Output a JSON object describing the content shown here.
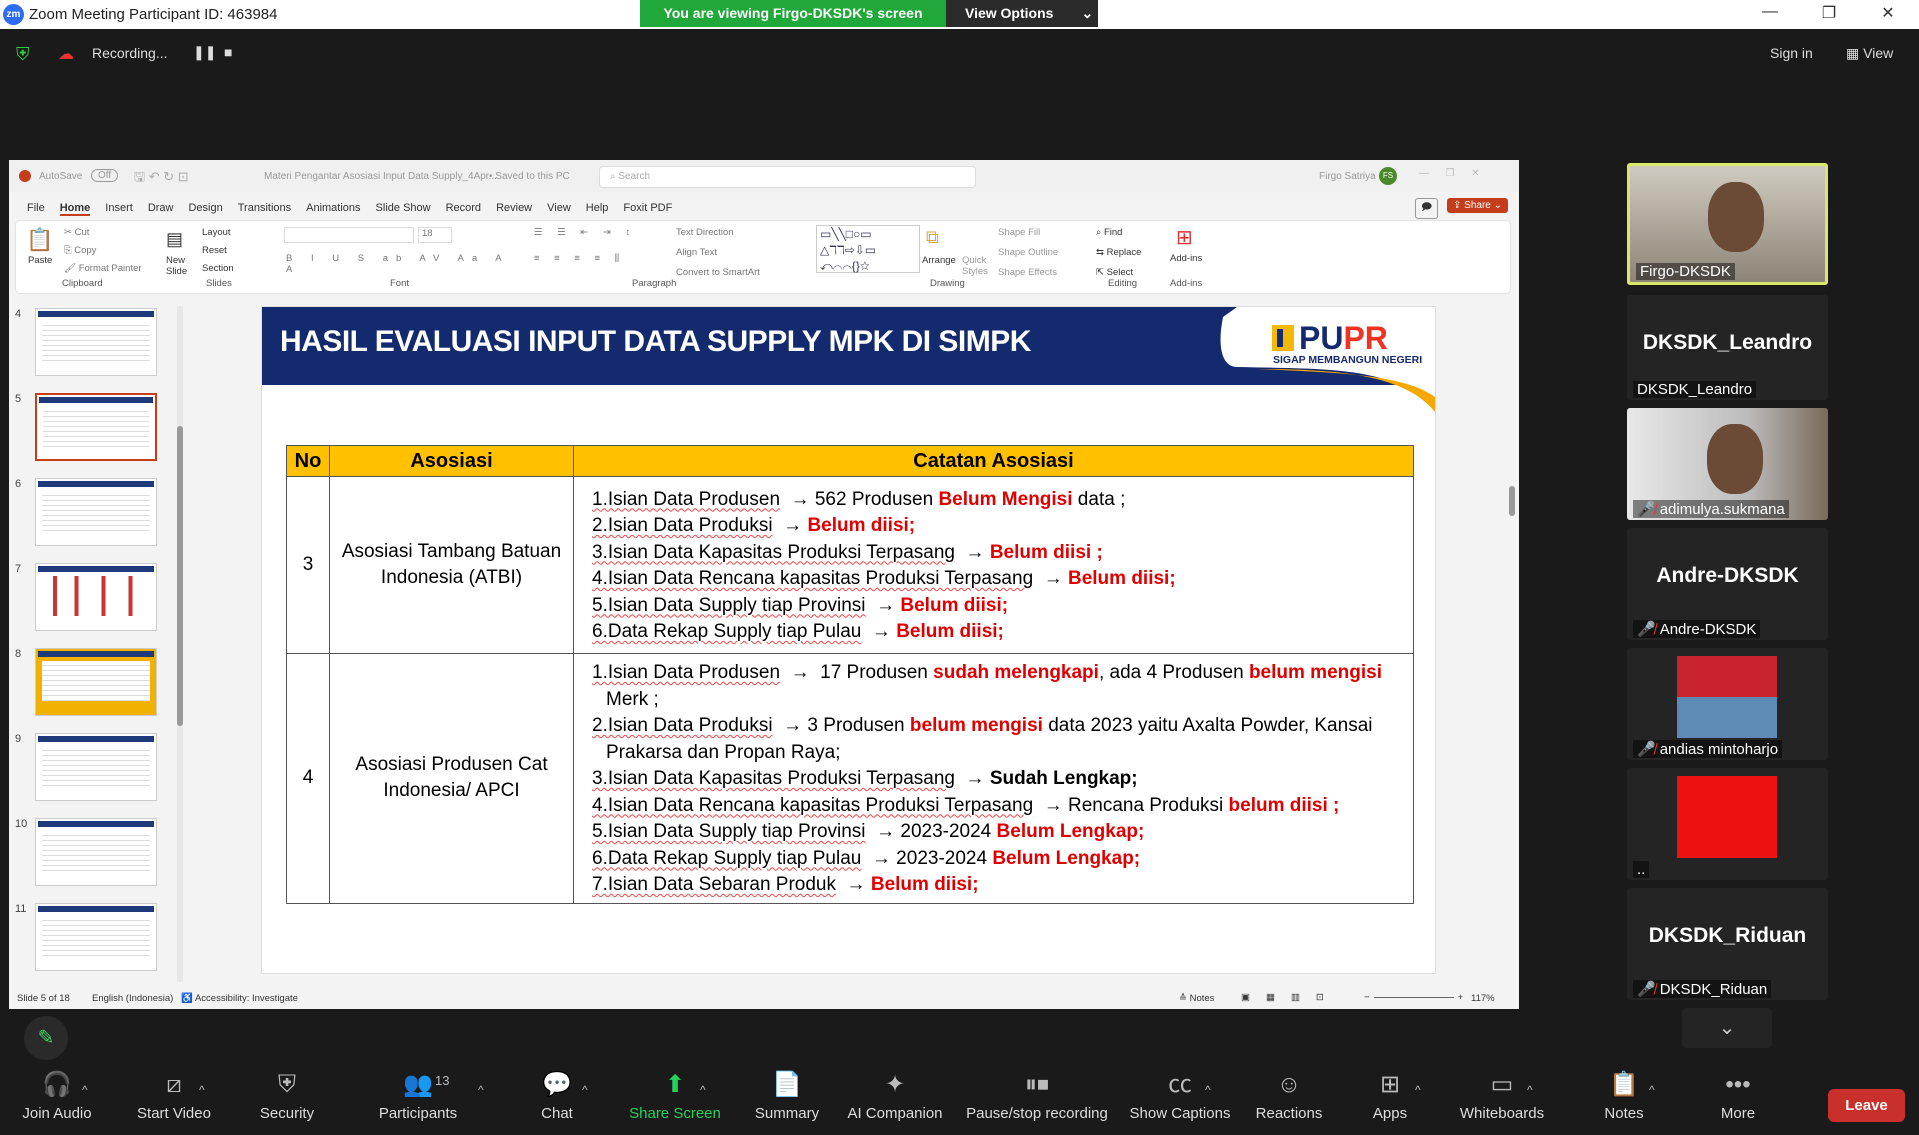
{
  "window": {
    "title": "Zoom Meeting Participant ID: 463984",
    "logo": "zm",
    "viewing": "You are viewing Firgo-DKSDK's screen",
    "view_options": "View Options"
  },
  "recording": {
    "label": "Recording...",
    "sign_in": "Sign in",
    "view": "View"
  },
  "ppt": {
    "autosave": "AutoSave",
    "autosave_state": "Off",
    "filename": "Materi Pengantar Asosiasi Input Data Supply_4Apr...",
    "saved": "• Saved to this PC",
    "search_placeholder": "Search",
    "user": "Firgo Satriya",
    "user_initials": "FS",
    "tabs": [
      "File",
      "Home",
      "Insert",
      "Draw",
      "Design",
      "Transitions",
      "Animations",
      "Slide Show",
      "Record",
      "Review",
      "View",
      "Help",
      "Foxit PDF"
    ],
    "share": "Share",
    "groups": {
      "clipboard": "Clipboard",
      "slides": "Slides",
      "font": "Font",
      "paragraph": "Paragraph",
      "drawing": "Drawing",
      "editing": "Editing",
      "addins": "Add-ins"
    },
    "buttons": {
      "paste": "Paste",
      "cut": "Cut",
      "copy": "Copy",
      "format_painter": "Format Painter",
      "new_slide": "New Slide",
      "layout": "Layout",
      "reset": "Reset",
      "section": "Section",
      "font_size": "18",
      "text_direction": "Text Direction",
      "align_text": "Align Text",
      "convert_smartart": "Convert to SmartArt",
      "arrange": "Arrange",
      "quick_styles": "Quick Styles",
      "shape_fill": "Shape Fill",
      "shape_outline": "Shape Outline",
      "shape_effects": "Shape Effects",
      "find": "Find",
      "replace": "Replace",
      "select": "Select",
      "addins": "Add-ins"
    },
    "thumbnails": [
      "4",
      "5",
      "6",
      "7",
      "8",
      "9",
      "10",
      "11"
    ],
    "active_thumbnail": "5",
    "status": {
      "slide": "Slide 5 of 18",
      "language": "English (Indonesia)",
      "accessibility": "Accessibility: Investigate",
      "notes": "Notes",
      "zoom": "117%"
    }
  },
  "slide": {
    "title": "HASIL EVALUASI INPUT DATA SUPPLY MPK DI SIMPK",
    "logo": "PUPR",
    "logo_tagline": "SIGAP MEMBANGUN NEGERI",
    "headers": [
      "No",
      "Asosiasi",
      "Catatan Asosiasi"
    ],
    "rows": [
      {
        "no": "3",
        "asosiasi": "Asosiasi Tambang Batuan Indonesia (ATBI)",
        "notes": [
          [
            [
              "1.Isian Data Produsen",
              "u"
            ],
            [
              "  → 562 Produsen ",
              ""
            ],
            [
              "Belum Mengisi",
              "r"
            ],
            [
              " data ;",
              ""
            ]
          ],
          [
            [
              "2.Isian Data Produksi",
              "u"
            ],
            [
              "  → ",
              ""
            ],
            [
              "Belum diisi;",
              "r"
            ]
          ],
          [
            [
              "3.Isian Data Kapasitas Produksi Terpasang",
              "u"
            ],
            [
              "  → ",
              ""
            ],
            [
              "Belum diisi ;",
              "r"
            ]
          ],
          [
            [
              "4.Isian Data Rencana kapasitas Produksi Terpasang",
              "u"
            ],
            [
              "  → ",
              ""
            ],
            [
              "Belum diisi;",
              "r"
            ]
          ],
          [
            [
              "5.Isian Data Supply tiap Provinsi",
              "u"
            ],
            [
              "  → ",
              ""
            ],
            [
              "Belum diisi;",
              "r"
            ]
          ],
          [
            [
              "6.Data Rekap Supply tiap Pulau",
              "u"
            ],
            [
              "  → ",
              ""
            ],
            [
              "Belum diisi;",
              "r"
            ]
          ]
        ]
      },
      {
        "no": "4",
        "asosiasi": "Asosiasi Produsen Cat Indonesia/ APCI",
        "notes": [
          [
            [
              "1.Isian Data Produsen",
              "u"
            ],
            [
              "  →  17 Produsen ",
              ""
            ],
            [
              "sudah melengkapi",
              "r"
            ],
            [
              ", ada 4 Produsen ",
              ""
            ],
            [
              "belum mengisi",
              "r"
            ],
            [
              " Merk ;",
              ""
            ]
          ],
          [
            [
              "2.Isian Data Produksi",
              "u"
            ],
            [
              "  → 3 Produsen ",
              ""
            ],
            [
              "belum mengisi",
              "r"
            ],
            [
              " data 2023 yaitu Axalta Powder, Kansai Prakarsa dan Propan Raya;",
              ""
            ]
          ],
          [
            [
              "3.Isian Data Kapasitas Produksi Terpasang",
              "u"
            ],
            [
              "  → ",
              ""
            ],
            [
              "Sudah Lengkap;",
              "b"
            ]
          ],
          [
            [
              "4.Isian Data Rencana kapasitas Produksi Terpasang",
              "u"
            ],
            [
              "  → Rencana Produksi ",
              ""
            ],
            [
              "belum diisi ;",
              "r"
            ]
          ],
          [
            [
              "5.Isian Data Supply tiap Provinsi",
              "u"
            ],
            [
              "  → 2023-2024 ",
              ""
            ],
            [
              "Belum Lengkap;",
              "r"
            ]
          ],
          [
            [
              "6.Data Rekap Supply tiap Pulau",
              "u"
            ],
            [
              "  → 2023-2024 ",
              ""
            ],
            [
              "Belum Lengkap;",
              "r"
            ]
          ],
          [
            [
              "7.Isian Data Sebaran Produk",
              "u"
            ],
            [
              "  → ",
              ""
            ],
            [
              "Belum diisi;",
              "r"
            ]
          ]
        ]
      }
    ]
  },
  "participants": [
    {
      "name": "Firgo-DKSDK",
      "type": "video",
      "active": true
    },
    {
      "name": "DKSDK_Leandro",
      "big": "DKSDK_Leandro",
      "type": "name"
    },
    {
      "name": "adimulya.sukmana",
      "type": "video",
      "muted": true
    },
    {
      "name": "Andre-DKSDK",
      "big": "Andre-DKSDK",
      "type": "name",
      "muted": true
    },
    {
      "name": "andias mintoharjo",
      "type": "image",
      "muted": true
    },
    {
      "name": "..",
      "type": "image"
    },
    {
      "name": "DKSDK_Riduan",
      "big": "DKSDK_Riduan",
      "type": "name",
      "muted": true
    }
  ],
  "toolbar": [
    {
      "label": "Join Audio",
      "icon": "headphones-icon",
      "glyph": "🎧",
      "caret": true
    },
    {
      "label": "Start Video",
      "icon": "video-off-icon",
      "glyph": "⧄",
      "caret": true
    },
    {
      "label": "Security",
      "icon": "shield-icon",
      "glyph": "⛨"
    },
    {
      "label": "Participants",
      "icon": "participants-icon",
      "glyph": "👥",
      "count": "13",
      "caret": true
    },
    {
      "label": "Chat",
      "icon": "chat-icon",
      "glyph": "💬",
      "caret": true
    },
    {
      "label": "Share Screen",
      "icon": "share-screen-icon",
      "glyph": "⬆",
      "caret": true,
      "accent": "#22d35a"
    },
    {
      "label": "Summary",
      "icon": "summary-icon",
      "glyph": "📄"
    },
    {
      "label": "AI Companion",
      "icon": "ai-companion-icon",
      "glyph": "✦"
    },
    {
      "label": "Pause/stop recording",
      "icon": "pause-stop-icon",
      "glyph": "⏸⏹"
    },
    {
      "label": "Show Captions",
      "icon": "captions-icon",
      "glyph": "㏄",
      "caret": true
    },
    {
      "label": "Reactions",
      "icon": "reactions-icon",
      "glyph": "☺"
    },
    {
      "label": "Apps",
      "icon": "apps-icon",
      "glyph": "⊞",
      "caret": true
    },
    {
      "label": "Whiteboards",
      "icon": "whiteboard-icon",
      "glyph": "▭",
      "caret": true
    },
    {
      "label": "Notes",
      "icon": "notes-icon",
      "glyph": "📋",
      "caret": true
    },
    {
      "label": "More",
      "icon": "more-icon",
      "glyph": "•••"
    }
  ],
  "leave": "Leave",
  "colors": {
    "zoom_green": "#21a83a",
    "pupr_navy": "#142a6e",
    "header_yellow": "#ffc000",
    "alert_red": "#e00000",
    "leave_red": "#c9302c"
  }
}
